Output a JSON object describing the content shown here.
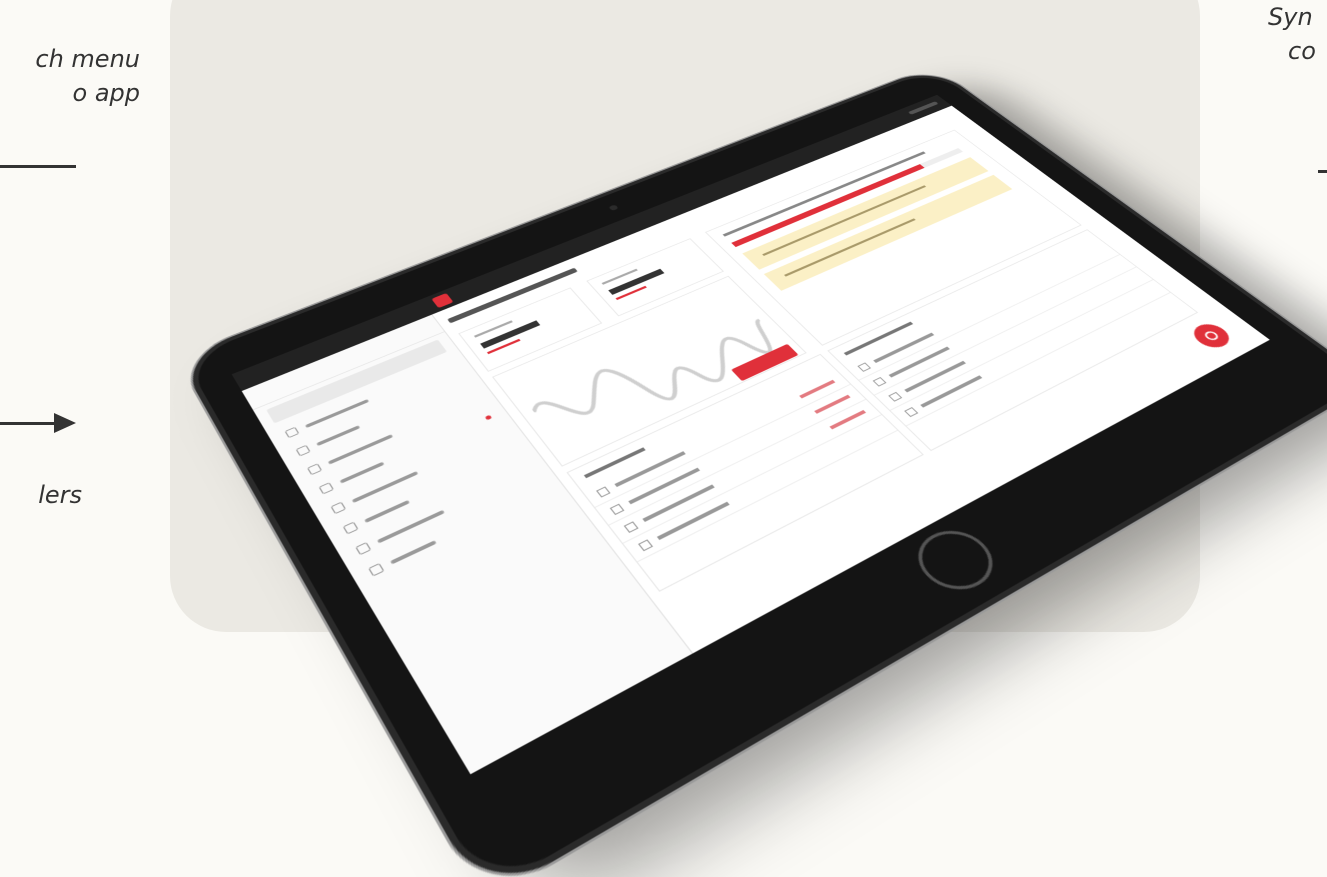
{
  "captions": {
    "left_top_line1": "ch menu",
    "left_top_line2": "o app",
    "left_bottom": "lers",
    "right_top_line1": "Syn",
    "right_top_line2": "co"
  },
  "colors": {
    "accent": "#e0303a",
    "stage": "#ebe9e3",
    "background": "#fbfaf6",
    "device": "#141414",
    "warning": "#fbf0c6"
  },
  "icons": {
    "app_logo": "logo-icon",
    "fab": "record-icon",
    "home": "home-button-icon"
  },
  "tablet_screen": {
    "sidebar_items": 8,
    "progress": [
      0.82,
      0.5
    ],
    "task_list_left_rows": 4,
    "task_list_right_rows": 4
  }
}
